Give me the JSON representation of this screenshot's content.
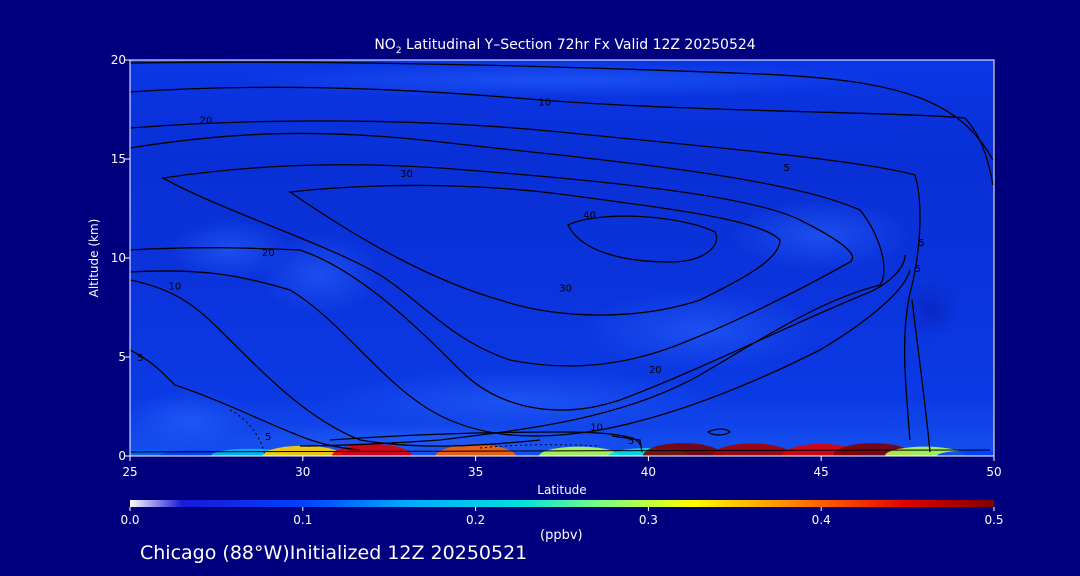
{
  "chart_data": {
    "type": "heatmap",
    "title_prefix": "NO",
    "title_subscript": "2",
    "title_suffix": " Latitudinal Y–Section 72hr  Fx Valid 12Z 20250524",
    "xlabel": "Latitude",
    "ylabel": "Altitude (km)",
    "xlim": [
      25,
      50
    ],
    "ylim": [
      0,
      20
    ],
    "x_ticks": [
      25,
      30,
      35,
      40,
      45,
      50
    ],
    "y_ticks": [
      0,
      5,
      10,
      15,
      20
    ],
    "colorbar": {
      "min": 0.0,
      "max": 0.5,
      "ticks": [
        "0.0",
        "0.1",
        "0.2",
        "0.3",
        "0.4",
        "0.5"
      ],
      "unit": "(ppbv)"
    },
    "surface_layer": [
      {
        "lat": 25.5,
        "value": 0.12
      },
      {
        "lat": 27.0,
        "value": 0.1
      },
      {
        "lat": 28.5,
        "value": 0.18
      },
      {
        "lat": 30.0,
        "value": 0.35
      },
      {
        "lat": 32.0,
        "value": 0.45
      },
      {
        "lat": 35.0,
        "value": 0.4
      },
      {
        "lat": 38.0,
        "value": 0.3
      },
      {
        "lat": 40.0,
        "value": 0.22
      },
      {
        "lat": 41.0,
        "value": 0.5
      },
      {
        "lat": 43.0,
        "value": 0.48
      },
      {
        "lat": 45.0,
        "value": 0.45
      },
      {
        "lat": 46.5,
        "value": 0.5
      },
      {
        "lat": 48.0,
        "value": 0.3
      },
      {
        "lat": 49.5,
        "value": 0.1
      }
    ],
    "contour_labels": [
      {
        "text": "10",
        "lat": 37.0,
        "alt": 17.9
      },
      {
        "text": "20",
        "lat": 27.2,
        "alt": 17.0
      },
      {
        "text": "30",
        "lat": 33.0,
        "alt": 14.3
      },
      {
        "text": "40",
        "lat": 38.3,
        "alt": 12.2
      },
      {
        "text": "20",
        "lat": 29.0,
        "alt": 10.3
      },
      {
        "text": "30",
        "lat": 37.6,
        "alt": 8.5
      },
      {
        "text": "10",
        "lat": 26.3,
        "alt": 8.6
      },
      {
        "text": "20",
        "lat": 40.2,
        "alt": 4.4
      },
      {
        "text": "10",
        "lat": 38.5,
        "alt": 1.5
      },
      {
        "text": "5",
        "lat": 25.3,
        "alt": 5.0
      },
      {
        "text": "5",
        "lat": 39.5,
        "alt": 0.8
      },
      {
        "text": "5",
        "lat": 29.0,
        "alt": 1.0
      },
      {
        "text": "5",
        "lat": 44.0,
        "alt": 14.6
      },
      {
        "text": "5",
        "lat": 47.9,
        "alt": 10.8
      },
      {
        "text": "5",
        "lat": 47.8,
        "alt": 9.5
      }
    ]
  },
  "footer": {
    "location": "Chicago (88°W)",
    "initialized": "Initialized 12Z 20250521"
  },
  "colors": {
    "background": "#00007f",
    "field_base": "#0a2fd8",
    "contour": "#000000"
  }
}
